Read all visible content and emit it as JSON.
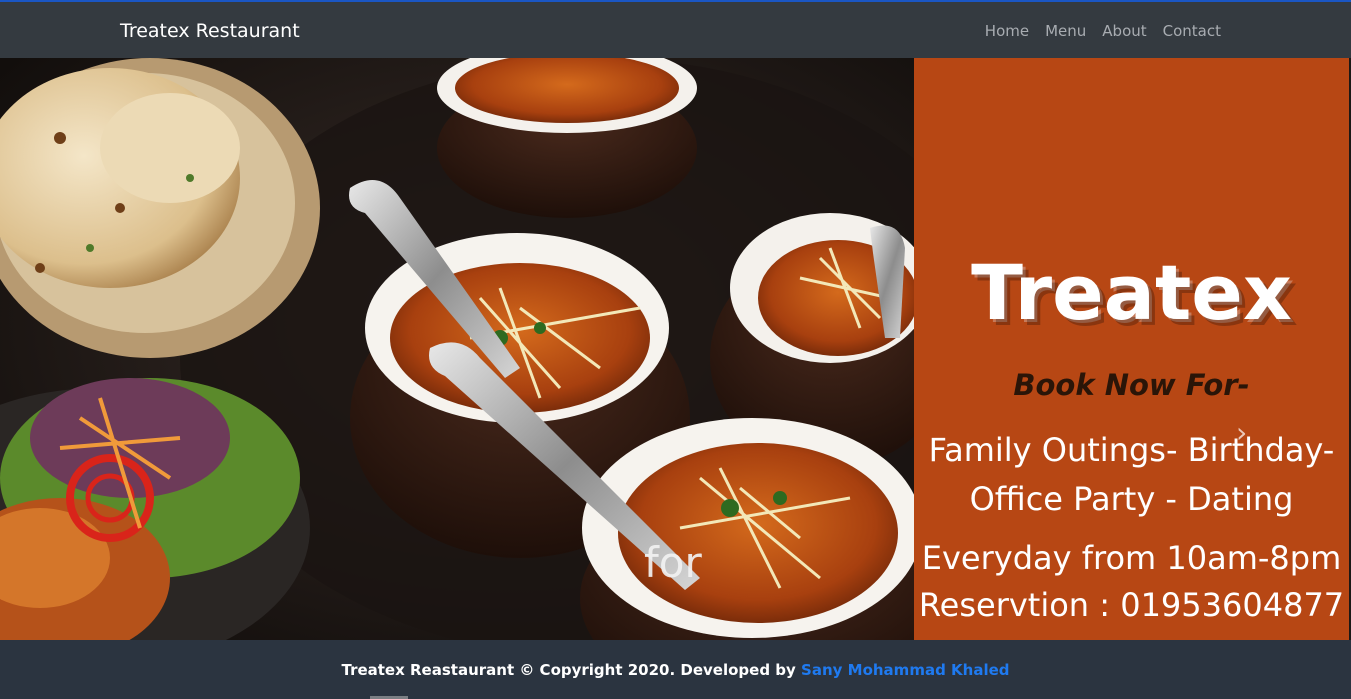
{
  "navbar": {
    "brand": "Treatex Restaurant",
    "links": [
      "Home",
      "Menu",
      "About",
      "Contact"
    ]
  },
  "hero": {
    "image_icon": "indian-curry-bowls-photo",
    "caption": "for",
    "next_icon": "chevron-right-icon",
    "next_glyph": "›"
  },
  "promo": {
    "title": "Treatex",
    "subtitle": "Book Now For-",
    "occasions_line1": "Family Outings- Birthday-",
    "occasions_line2": "Office Party - Dating",
    "hours": "Everyday from 10am-8pm",
    "reservation": "Reservtion : 01953604877",
    "background_color": "#b74714"
  },
  "footer": {
    "text": "Treatex Reastaurant © Copyright 2020. Developed by ",
    "author": "Sany Mohammad Khaled",
    "link_color": "#1f7af0"
  }
}
